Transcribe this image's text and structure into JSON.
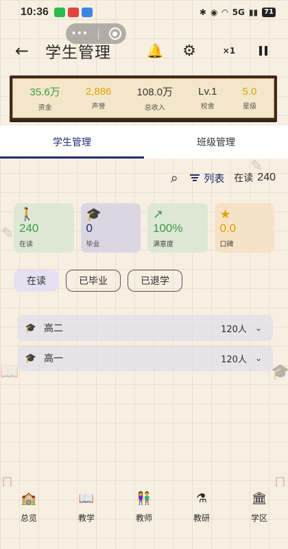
{
  "status_bar": {
    "time": "10:36",
    "battery": "71",
    "signal": "5G"
  },
  "header": {
    "title": "学生管理",
    "speed": "×1"
  },
  "resources": [
    {
      "value": "35.6万",
      "label": "资金",
      "color": "#3a9a4a"
    },
    {
      "value": "2,886",
      "label": "声誉",
      "color": "#e0a000"
    },
    {
      "value": "108.0万",
      "label": "总收入",
      "color": "#333333"
    },
    {
      "value": "Lv.1",
      "label": "校舍",
      "color": "#333333"
    },
    {
      "value": "5.0",
      "label": "星级",
      "color": "#e0a000"
    }
  ],
  "tabs": [
    {
      "label": "学生管理",
      "active": true
    },
    {
      "label": "班级管理",
      "active": false
    }
  ],
  "toolbar": {
    "view_mode": "列表",
    "count_label": "在读",
    "count_value": "240"
  },
  "stats": [
    {
      "icon": "person-walk-icon",
      "glyph": "🚶",
      "value": "240",
      "label": "在读",
      "bg": "#dfe8d4",
      "color": "#3a9a4a"
    },
    {
      "icon": "grad-cap-icon",
      "glyph": "🎓",
      "value": "0",
      "label": "毕业",
      "bg": "#dad7e2",
      "color": "#1f2a6e"
    },
    {
      "icon": "trend-up-icon",
      "glyph": "↗",
      "value": "100%",
      "label": "满意度",
      "bg": "#dfe8d4",
      "color": "#3a9a4a"
    },
    {
      "icon": "star-icon",
      "glyph": "★",
      "value": "0.0",
      "label": "口碑",
      "bg": "#f6e2c6",
      "color": "#e0a000"
    }
  ],
  "filters": [
    {
      "label": "在读",
      "active": true
    },
    {
      "label": "已毕业",
      "active": false
    },
    {
      "label": "已退学",
      "active": false
    }
  ],
  "grades": [
    {
      "name": "高二",
      "count": "120人"
    },
    {
      "name": "高一",
      "count": "120人"
    }
  ],
  "nav": [
    {
      "label": "总览",
      "icon": "school-icon",
      "glyph": "🏫"
    },
    {
      "label": "教学",
      "icon": "book-icon",
      "glyph": "📖"
    },
    {
      "label": "教师",
      "icon": "teachers-icon",
      "glyph": "👫"
    },
    {
      "label": "教研",
      "icon": "flask-icon",
      "glyph": "⚗"
    },
    {
      "label": "学区",
      "icon": "campus-icon",
      "glyph": "🏛"
    }
  ]
}
